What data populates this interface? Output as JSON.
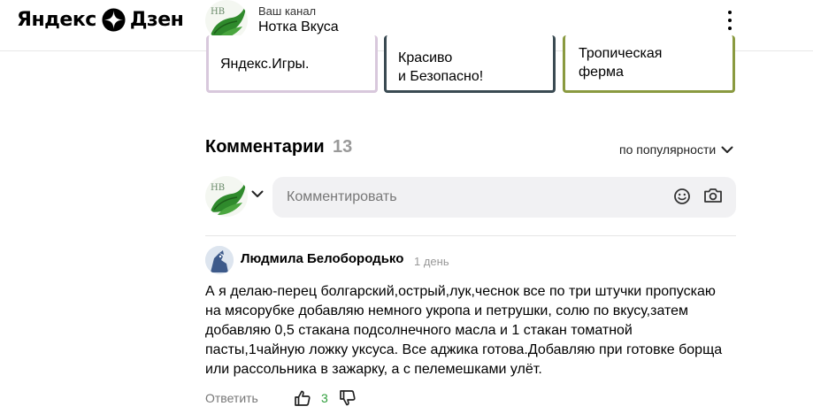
{
  "header": {
    "logo_left": "Яндекс",
    "logo_right": "Дзен",
    "channel_subtitle": "Ваш канал",
    "channel_name": "Нотка Вкуса"
  },
  "cards": [
    {
      "text": "Яндекс.Игры."
    },
    {
      "line1": "Красиво",
      "line2": "и Безопасно!"
    },
    {
      "line1": "Тропическая",
      "line2": "ферма"
    }
  ],
  "comments": {
    "title": "Комментарии",
    "count": "13",
    "sort_label": "по популярности",
    "input_placeholder": "Комментировать"
  },
  "comment": {
    "author": "Людмила Белобородько",
    "time": "1 день",
    "lines": [
      "А я делаю-перец болгарский,острый,лук,чеснок все по три штучки пропускаю",
      "на мясорубке добавляю немного укропа и петрушки, солю по вкусу,затем",
      "добавляю 0,5 стакана подсолнечного масла и 1 стакан томатной",
      "пасты,1чайную ложку уксуса. Все аджика готова.Добавляю при готовке борща",
      "или рассольника в зажарку, а с пелемешками улёт."
    ],
    "reply_label": "Ответить",
    "likes": "3"
  },
  "colors": {
    "like_count": "#2e9e3a",
    "input_bg": "#f1f1f3",
    "muted_text": "#999999"
  },
  "icons": [
    "zen-star-icon",
    "kebab-menu-icon",
    "chevron-down-icon",
    "emoji-icon",
    "camera-icon",
    "thumbs-up-icon",
    "thumbs-down-icon"
  ]
}
